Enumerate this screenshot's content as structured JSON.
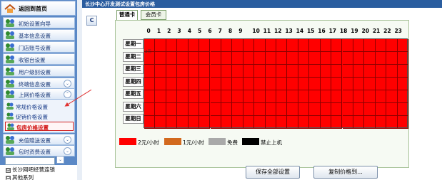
{
  "sidebar": {
    "home_label": "返回到首页",
    "items": [
      {
        "label": "初始设置向导",
        "icon": "group-icon",
        "chevron": ""
      },
      {
        "label": "基本信息设置",
        "icon": "group-icon",
        "chevron": ""
      },
      {
        "label": "门店账号设置",
        "icon": "group-icon",
        "chevron": ""
      },
      {
        "label": "收银台设置",
        "icon": "group-icon",
        "chevron": ""
      },
      {
        "label": "用户级别设置",
        "icon": "group-icon",
        "chevron": ""
      },
      {
        "label": "终端信息设置",
        "icon": "group-icon",
        "chevron": "⌄"
      },
      {
        "label": "上网价格设置",
        "icon": "group-icon",
        "chevron": "⌃"
      }
    ],
    "sub_items": [
      {
        "label": "常规价格设置",
        "active": false
      },
      {
        "label": "促销价格设置",
        "active": false
      },
      {
        "label": "包房价格设置",
        "active": true
      }
    ],
    "items_after": [
      {
        "label": "充值赠送设置",
        "chevron": "⌄"
      },
      {
        "label": "包时资费设置",
        "chevron": "⌄"
      }
    ],
    "input_chevron": "⌄",
    "tree": [
      {
        "toggle": "⊟",
        "label": "长沙网吧经营连锁"
      },
      {
        "toggle": "⊟",
        "label": "其他系列"
      }
    ]
  },
  "titlebar": {
    "title": "长沙中心开发测试设置包房价格"
  },
  "main": {
    "c_button": "C",
    "tabs": [
      {
        "label": "普通卡",
        "active": true
      },
      {
        "label": "会员卡",
        "active": false
      }
    ],
    "hours": [
      "0",
      "1",
      "2",
      "3",
      "4",
      "5",
      "6",
      "7",
      "8",
      "9",
      "10",
      "11",
      "12",
      "13",
      "14",
      "15",
      "16",
      "17",
      "18",
      "19",
      "20",
      "21",
      "22",
      "23"
    ],
    "days": [
      "星期一",
      "星期二",
      "星期三",
      "星期四",
      "星期五",
      "星期六",
      "星期日"
    ],
    "cell_note": "2元",
    "all_cells_rate": "2元/小时",
    "legend": [
      {
        "color": "#ff0000",
        "label": "2元/小时"
      },
      {
        "color": "#d2691e",
        "label": "1元/小时"
      },
      {
        "color": "#a9a9a9",
        "label": "免费"
      },
      {
        "color": "#000000",
        "label": "禁止上机"
      }
    ],
    "buttons": {
      "save_all": "保存全部设置",
      "copy_price": "复制价格到..."
    }
  },
  "colors": {
    "sidebar_bg": "#5a88c6",
    "titlebar_bg": "#2a5d9f",
    "grid_fill": "#ff0000",
    "active_red": "#d01010"
  }
}
